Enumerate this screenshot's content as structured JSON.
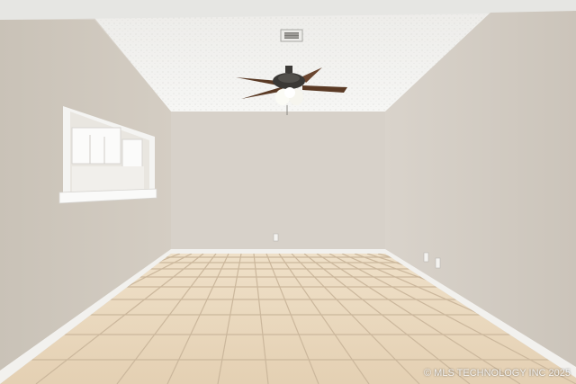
{
  "photo": {
    "subject": "empty-room-with-ceiling-fan",
    "watermark": "© MLS TECHNOLOGY INC 2025"
  },
  "colors": {
    "ceiling": "#f3f3f1",
    "left_wall": "#cfc8bd",
    "back_wall": "#d9d3cb",
    "right_wall": "#d6cfc6",
    "floor_tile": "#e8d5b9",
    "grout": "#cbb79c",
    "baseboard": "#f2f1ee",
    "fan_blade": "#5a3a25"
  }
}
